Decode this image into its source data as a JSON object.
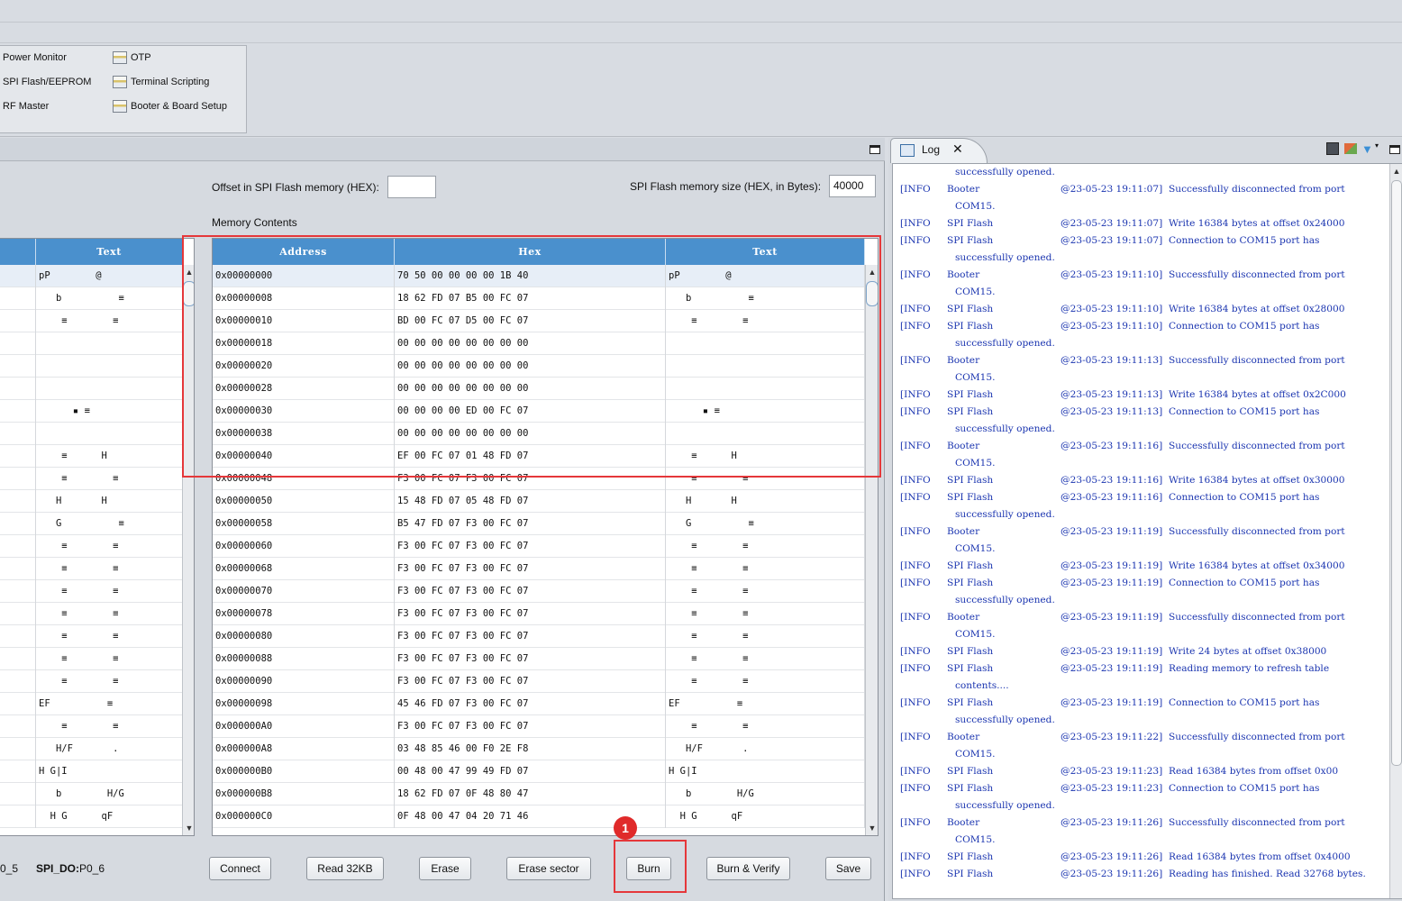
{
  "tools": [
    {
      "label": "Power Monitor",
      "icon": "tool-icon"
    },
    {
      "label": "OTP",
      "icon": "tool-icon"
    },
    {
      "label": "SPI Flash/EEPROM",
      "icon": "tool-icon"
    },
    {
      "label": "Terminal Scripting",
      "icon": "tool-icon"
    },
    {
      "label": "RF Master",
      "icon": "tool-icon"
    },
    {
      "label": "Booter & Board Setup",
      "icon": "tool-icon"
    }
  ],
  "main": {
    "offset_label": "Offset in SPI Flash memory (HEX):",
    "offset_value": "",
    "size_label": "SPI Flash memory size (HEX, in Bytes):",
    "size_value": "40000",
    "memory_contents_label": "Memory Contents",
    "pins": {
      "partial": "0_5",
      "spi_do_label": "SPI_DO:",
      "spi_do_value": "P0_6"
    }
  },
  "left_grid": {
    "header": "Text",
    "rows": [
      "pP        @",
      "   b          ≡",
      "    ≡        ≡",
      "",
      "",
      "",
      "      ▪ ≡",
      "",
      "    ≡      H",
      "    ≡        ≡",
      "   H       H",
      "   G          ≡",
      "    ≡        ≡",
      "    ≡        ≡",
      "    ≡        ≡",
      "    ≡        ≡",
      "    ≡        ≡",
      "    ≡        ≡",
      "    ≡        ≡",
      "EF          ≡",
      "    ≡        ≡",
      "   H/F       .",
      "H G|I",
      "   b        H/G",
      "  H G      qF"
    ]
  },
  "memory_grid": {
    "headers": [
      "Address",
      "Hex",
      "Text"
    ],
    "rows": [
      [
        "0x00000000",
        "70 50 00 00 00 00 1B 40",
        "pP        @"
      ],
      [
        "0x00000008",
        "18 62 FD 07 B5 00 FC 07",
        "   b          ≡"
      ],
      [
        "0x00000010",
        "BD 00 FC 07 D5 00 FC 07",
        "    ≡        ≡"
      ],
      [
        "0x00000018",
        "00 00 00 00 00 00 00 00",
        ""
      ],
      [
        "0x00000020",
        "00 00 00 00 00 00 00 00",
        ""
      ],
      [
        "0x00000028",
        "00 00 00 00 00 00 00 00",
        ""
      ],
      [
        "0x00000030",
        "00 00 00 00 ED 00 FC 07",
        "      ▪ ≡"
      ],
      [
        "0x00000038",
        "00 00 00 00 00 00 00 00",
        ""
      ],
      [
        "0x00000040",
        "EF 00 FC 07 01 48 FD 07",
        "    ≡      H"
      ],
      [
        "0x00000048",
        "F3 00 FC 07 F3 00 FC 07",
        "    ≡        ≡"
      ],
      [
        "0x00000050",
        "15 48 FD 07 05 48 FD 07",
        "   H       H"
      ],
      [
        "0x00000058",
        "B5 47 FD 07 F3 00 FC 07",
        "   G          ≡"
      ],
      [
        "0x00000060",
        "F3 00 FC 07 F3 00 FC 07",
        "    ≡        ≡"
      ],
      [
        "0x00000068",
        "F3 00 FC 07 F3 00 FC 07",
        "    ≡        ≡"
      ],
      [
        "0x00000070",
        "F3 00 FC 07 F3 00 FC 07",
        "    ≡        ≡"
      ],
      [
        "0x00000078",
        "F3 00 FC 07 F3 00 FC 07",
        "    ≡        ≡"
      ],
      [
        "0x00000080",
        "F3 00 FC 07 F3 00 FC 07",
        "    ≡        ≡"
      ],
      [
        "0x00000088",
        "F3 00 FC 07 F3 00 FC 07",
        "    ≡        ≡"
      ],
      [
        "0x00000090",
        "F3 00 FC 07 F3 00 FC 07",
        "    ≡        ≡"
      ],
      [
        "0x00000098",
        "45 46 FD 07 F3 00 FC 07",
        "EF          ≡"
      ],
      [
        "0x000000A0",
        "F3 00 FC 07 F3 00 FC 07",
        "    ≡        ≡"
      ],
      [
        "0x000000A8",
        "03 48 85 46 00 F0 2E F8",
        "   H/F       ."
      ],
      [
        "0x000000B0",
        "00 48 00 47 99 49 FD 07",
        "H G|I"
      ],
      [
        "0x000000B8",
        "18 62 FD 07 0F 48 80 47",
        "   b        H/G"
      ],
      [
        "0x000000C0",
        "0F 48 00 47 04 20 71 46",
        "  H G      qF"
      ]
    ]
  },
  "buttons": [
    {
      "label": "Connect",
      "name": "connect-button"
    },
    {
      "label": "Read 32KB",
      "name": "read-32kb-button"
    },
    {
      "label": "Erase",
      "name": "erase-button"
    },
    {
      "label": "Erase sector",
      "name": "erase-sector-button"
    },
    {
      "label": "Burn",
      "name": "burn-button"
    },
    {
      "label": "Burn & Verify",
      "name": "burn-verify-button"
    },
    {
      "label": "Save",
      "name": "save-button"
    }
  ],
  "annotation": {
    "badge": "1",
    "color": "#e5373a"
  },
  "log": {
    "tab_label": "Log",
    "lines": [
      [
        "",
        "",
        "",
        "successfully opened."
      ],
      [
        "[INFO",
        "Booter",
        "@23-05-23 19:11:07]",
        "Successfully disconnected from port"
      ],
      [
        "",
        "",
        "",
        "COM15."
      ],
      [
        "[INFO",
        "SPI Flash",
        "@23-05-23 19:11:07]",
        "Write 16384 bytes at offset 0x24000"
      ],
      [
        "[INFO",
        "SPI Flash",
        "@23-05-23 19:11:07]",
        "Connection to COM15 port has"
      ],
      [
        "",
        "",
        "",
        "successfully opened."
      ],
      [
        "[INFO",
        "Booter",
        "@23-05-23 19:11:10]",
        "Successfully disconnected from port"
      ],
      [
        "",
        "",
        "",
        "COM15."
      ],
      [
        "[INFO",
        "SPI Flash",
        "@23-05-23 19:11:10]",
        "Write 16384 bytes at offset 0x28000"
      ],
      [
        "[INFO",
        "SPI Flash",
        "@23-05-23 19:11:10]",
        "Connection to COM15 port has"
      ],
      [
        "",
        "",
        "",
        "successfully opened."
      ],
      [
        "[INFO",
        "Booter",
        "@23-05-23 19:11:13]",
        "Successfully disconnected from port"
      ],
      [
        "",
        "",
        "",
        "COM15."
      ],
      [
        "[INFO",
        "SPI Flash",
        "@23-05-23 19:11:13]",
        "Write 16384 bytes at offset 0x2C000"
      ],
      [
        "[INFO",
        "SPI Flash",
        "@23-05-23 19:11:13]",
        "Connection to COM15 port has"
      ],
      [
        "",
        "",
        "",
        "successfully opened."
      ],
      [
        "[INFO",
        "Booter",
        "@23-05-23 19:11:16]",
        "Successfully disconnected from port"
      ],
      [
        "",
        "",
        "",
        "COM15."
      ],
      [
        "[INFO",
        "SPI Flash",
        "@23-05-23 19:11:16]",
        "Write 16384 bytes at offset 0x30000"
      ],
      [
        "[INFO",
        "SPI Flash",
        "@23-05-23 19:11:16]",
        "Connection to COM15 port has"
      ],
      [
        "",
        "",
        "",
        "successfully opened."
      ],
      [
        "[INFO",
        "Booter",
        "@23-05-23 19:11:19]",
        "Successfully disconnected from port"
      ],
      [
        "",
        "",
        "",
        "COM15."
      ],
      [
        "[INFO",
        "SPI Flash",
        "@23-05-23 19:11:19]",
        "Write 16384 bytes at offset 0x34000"
      ],
      [
        "[INFO",
        "SPI Flash",
        "@23-05-23 19:11:19]",
        "Connection to COM15 port has"
      ],
      [
        "",
        "",
        "",
        "successfully opened."
      ],
      [
        "[INFO",
        "Booter",
        "@23-05-23 19:11:19]",
        "Successfully disconnected from port"
      ],
      [
        "",
        "",
        "",
        "COM15."
      ],
      [
        "[INFO",
        "SPI Flash",
        "@23-05-23 19:11:19]",
        "Write 24 bytes at offset 0x38000"
      ],
      [
        "[INFO",
        "SPI Flash",
        "@23-05-23 19:11:19]",
        "Reading memory to refresh table"
      ],
      [
        "",
        "",
        "",
        "contents...."
      ],
      [
        "[INFO",
        "SPI Flash",
        "@23-05-23 19:11:19]",
        "Connection to COM15 port has"
      ],
      [
        "",
        "",
        "",
        "successfully opened."
      ],
      [
        "[INFO",
        "Booter",
        "@23-05-23 19:11:22]",
        "Successfully disconnected from port"
      ],
      [
        "",
        "",
        "",
        "COM15."
      ],
      [
        "[INFO",
        "SPI Flash",
        "@23-05-23 19:11:23]",
        "Read 16384 bytes from offset 0x00"
      ],
      [
        "[INFO",
        "SPI Flash",
        "@23-05-23 19:11:23]",
        "Connection to COM15 port has"
      ],
      [
        "",
        "",
        "",
        "successfully opened."
      ],
      [
        "[INFO",
        "Booter",
        "@23-05-23 19:11:26]",
        "Successfully disconnected from port"
      ],
      [
        "",
        "",
        "",
        "COM15."
      ],
      [
        "[INFO",
        "SPI Flash",
        "@23-05-23 19:11:26]",
        "Read 16384 bytes from offset 0x4000"
      ],
      [
        "[INFO",
        "SPI Flash",
        "@23-05-23 19:11:26]",
        "Reading has finished. Read 32768 bytes."
      ]
    ]
  }
}
